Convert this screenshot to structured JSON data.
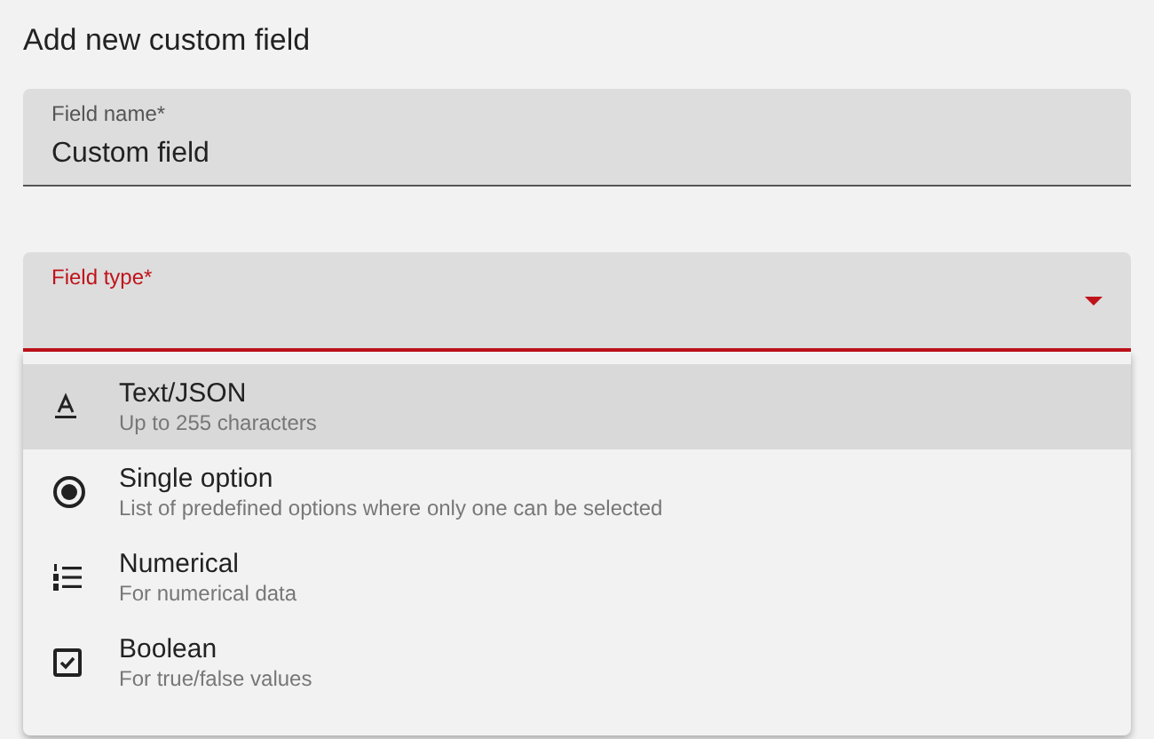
{
  "title": "Add new custom field",
  "name_field": {
    "label": "Field name*",
    "value": "Custom field"
  },
  "type_field": {
    "label": "Field type*",
    "error": true,
    "expanded": true
  },
  "options": [
    {
      "kind": "text",
      "label": "Text/JSON",
      "description": "Up to 255 characters",
      "selected": true
    },
    {
      "kind": "radio",
      "label": "Single option",
      "description": "List of predefined options where only one can be selected",
      "selected": false
    },
    {
      "kind": "numbered",
      "label": "Numerical",
      "description": "For numerical data",
      "selected": false
    },
    {
      "kind": "checkbox",
      "label": "Boolean",
      "description": "For true/false values",
      "selected": false
    }
  ]
}
